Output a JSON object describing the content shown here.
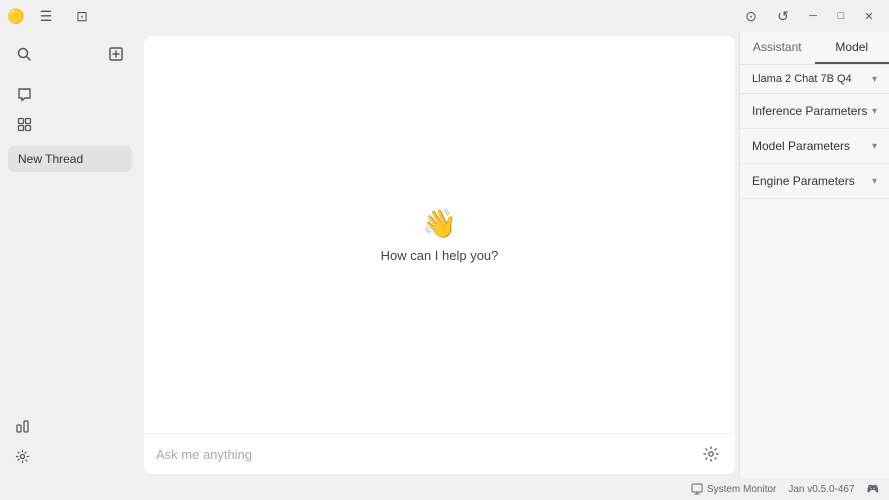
{
  "titlebar": {
    "app_icon": "🟡",
    "controls": [
      "minimize",
      "maximize",
      "close"
    ]
  },
  "sidebar": {
    "new_thread_label": "New Thread",
    "nav_icons": [
      "search",
      "grid"
    ],
    "bottom_icons": [
      "plugin",
      "settings"
    ]
  },
  "chat": {
    "welcome_icon": "👋",
    "welcome_text": "How can I help you?",
    "input_placeholder": "Ask me anything"
  },
  "right_panel": {
    "tabs": [
      {
        "label": "Assistant",
        "active": false
      },
      {
        "label": "Model",
        "active": true
      }
    ],
    "model": {
      "name": "Llama 2 Chat 7B Q4"
    },
    "sections": [
      {
        "label": "Inference Parameters"
      },
      {
        "label": "Model Parameters"
      },
      {
        "label": "Engine Parameters"
      }
    ]
  },
  "statusbar": {
    "system_monitor": "System Monitor",
    "version": "Jan v0.5.0-467",
    "gamepad_icon": "🎮"
  }
}
